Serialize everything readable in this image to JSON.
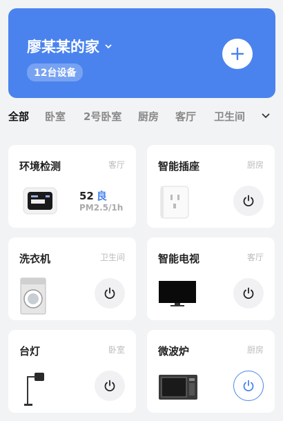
{
  "header": {
    "home_name": "廖某某的家",
    "device_count": "12台设备",
    "accent": "#4a83ee"
  },
  "tabs": [
    {
      "label": "全部",
      "active": true
    },
    {
      "label": "卧室"
    },
    {
      "label": "2号卧室"
    },
    {
      "label": "厨房"
    },
    {
      "label": "客厅"
    },
    {
      "label": "卫生间"
    }
  ],
  "devices": [
    {
      "name": "环境检测",
      "room": "客厅",
      "value": "52",
      "grade": "良",
      "unit": "PM2.5/1h",
      "icon": "air-monitor-icon"
    },
    {
      "name": "智能插座",
      "room": "厨房",
      "icon": "smart-plug-icon",
      "power": "off"
    },
    {
      "name": "洗衣机",
      "room": "卫生间",
      "icon": "washing-machine-icon",
      "power": "off"
    },
    {
      "name": "智能电视",
      "room": "客厅",
      "icon": "tv-icon",
      "power": "off"
    },
    {
      "name": "台灯",
      "room": "卧室",
      "icon": "desk-lamp-icon",
      "power": "off"
    },
    {
      "name": "微波炉",
      "room": "厨房",
      "icon": "microwave-icon",
      "power": "on"
    }
  ]
}
